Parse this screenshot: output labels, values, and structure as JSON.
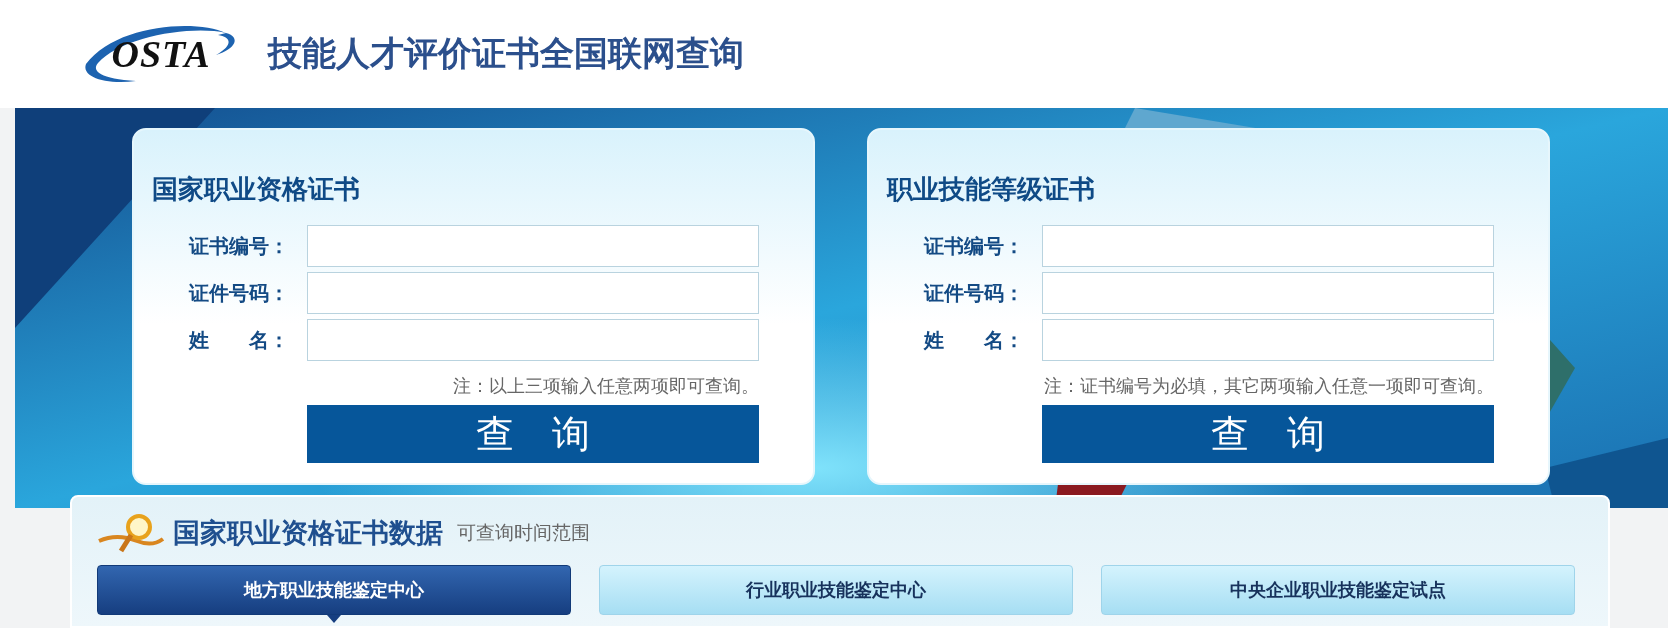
{
  "header": {
    "logo_text": "OSTA",
    "title": "技能人才评价证书全国联网查询"
  },
  "query_cards": [
    {
      "title": "国家职业资格证书",
      "fields": [
        {
          "label": "证书编号："
        },
        {
          "label": "证件号码："
        },
        {
          "label": "姓　　名："
        }
      ],
      "note": "注：以上三项输入任意两项即可查询。",
      "button": "查　询"
    },
    {
      "title": "职业技能等级证书",
      "fields": [
        {
          "label": "证书编号："
        },
        {
          "label": "证件号码："
        },
        {
          "label": "姓　　名："
        }
      ],
      "note": "注：证书编号为必填，其它两项输入任意一项即可查询。",
      "button": "查　询"
    }
  ],
  "data_section": {
    "title": "国家职业资格证书数据",
    "subtitle": "可查询时间范围",
    "tabs": [
      {
        "label": "地方职业技能鉴定中心",
        "selected": true
      },
      {
        "label": "行业职业技能鉴定中心",
        "selected": false
      },
      {
        "label": "中央企业职业技能鉴定试点",
        "selected": false
      }
    ]
  }
}
